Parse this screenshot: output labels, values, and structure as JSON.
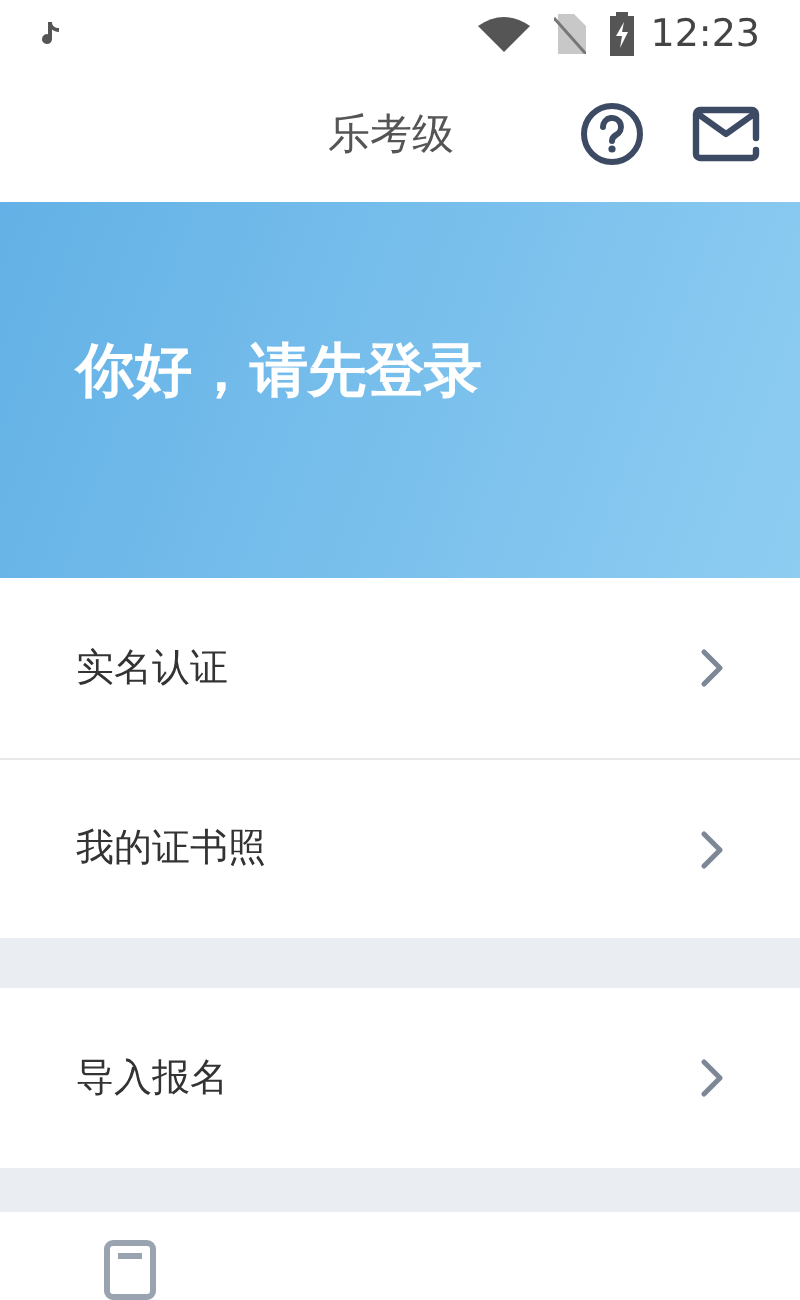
{
  "status_bar": {
    "time": "12:23"
  },
  "header": {
    "title": "乐考级"
  },
  "banner": {
    "greeting": "你好，请先登录"
  },
  "menu_groups": [
    [
      {
        "label": "实名认证"
      },
      {
        "label": "我的证书照"
      }
    ],
    [
      {
        "label": "导入报名"
      }
    ]
  ]
}
